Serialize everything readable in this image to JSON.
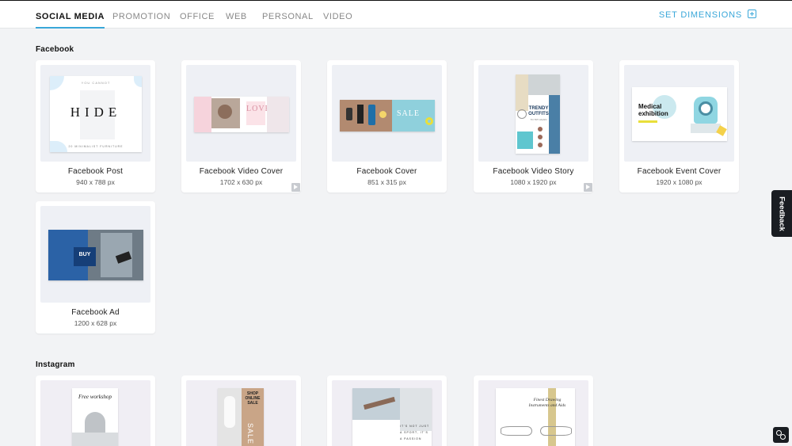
{
  "nav": {
    "tabs": [
      "SOCIAL MEDIA",
      "PROMOTION",
      "OFFICE",
      "WEB",
      "PERSONAL",
      "VIDEO"
    ],
    "active_tab": "SOCIAL MEDIA",
    "set_dimensions": "SET DIMENSIONS"
  },
  "sections": {
    "facebook": {
      "title": "Facebook",
      "cards": [
        {
          "name": "Facebook Post",
          "dims": "940 x 788 px",
          "thumb_text": "HIDE",
          "thumb_top": "YOU CANNOT",
          "thumb_bottom": "20 MINIMALIST FURNITURE"
        },
        {
          "name": "Facebook Video Cover",
          "dims": "1702 x 630 px",
          "thumb_text": "LOVE",
          "video": true
        },
        {
          "name": "Facebook Cover",
          "dims": "851 x 315 px",
          "thumb_text": "SALE"
        },
        {
          "name": "Facebook Video Story",
          "dims": "1080 x 1920 px",
          "thumb_text": "TRENDY OUTFITS",
          "thumb_sub": "TO TRY AGAIN",
          "video": true
        },
        {
          "name": "Facebook Event Cover",
          "dims": "1920 x 1080 px",
          "thumb_text": "Medical exhibition"
        },
        {
          "name": "Facebook Ad",
          "dims": "1200 x 628 px",
          "thumb_text": "BUY"
        }
      ]
    },
    "instagram": {
      "title": "Instagram",
      "cards": [
        {
          "thumb_text": "Free workshop"
        },
        {
          "thumb_text": "SHOP ONLINE SALE",
          "thumb_sub": "SALE"
        },
        {
          "thumb_text": "IT'S NOT JUST A SPORT, IT'S A PASSION"
        },
        {
          "thumb_text": "Finest Drawing Instruments and Aids"
        }
      ]
    }
  },
  "feedback": "Feedback",
  "colors": {
    "accent": "#3aa7d9",
    "dark": "#1a1d22",
    "background": "#f2f3f5"
  }
}
